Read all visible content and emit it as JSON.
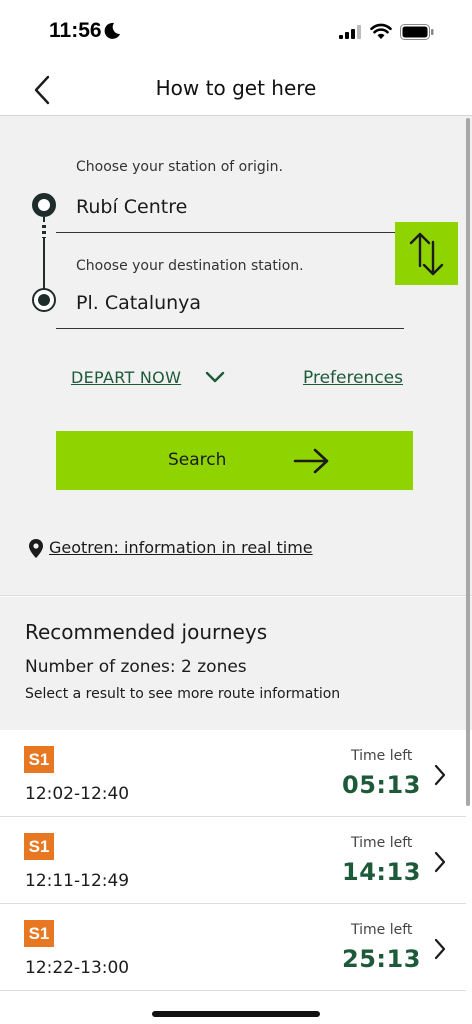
{
  "status_bar": {
    "time": "11:56"
  },
  "header": {
    "title": "How to get here"
  },
  "search_form": {
    "origin_hint": "Choose your station of origin.",
    "origin_value": "Rubí Centre",
    "destination_hint": "Choose your destination station.",
    "destination_value": "Pl. Catalunya",
    "depart_label": "DEPART NOW",
    "preferences_label": "Preferences",
    "search_label": "Search",
    "geotren_link": "Geotren: information in real time"
  },
  "results": {
    "title": "Recommended journeys",
    "zones": "Number of zones: 2 zones",
    "hint": "Select a result to see more route information",
    "journeys": [
      {
        "line": "S1",
        "time_range": "12:02-12:40",
        "time_left_label": "Time left",
        "time_left": "05:13"
      },
      {
        "line": "S1",
        "time_range": "12:11-12:49",
        "time_left_label": "Time left",
        "time_left": "14:13"
      },
      {
        "line": "S1",
        "time_range": "12:22-13:00",
        "time_left_label": "Time left",
        "time_left": "25:13"
      }
    ]
  },
  "colors": {
    "accent_green": "#8fd400",
    "link_green": "#1d5a3a",
    "line_badge": "#e87722",
    "panel_bg": "#f1f1f1"
  },
  "icons": {
    "back": "chevron-left-icon",
    "swap": "swap-vertical-icon",
    "depart_toggle": "chevron-down-icon",
    "search_arrow": "arrow-right-icon",
    "geotren": "map-pin-icon",
    "row": "chevron-right-icon"
  }
}
